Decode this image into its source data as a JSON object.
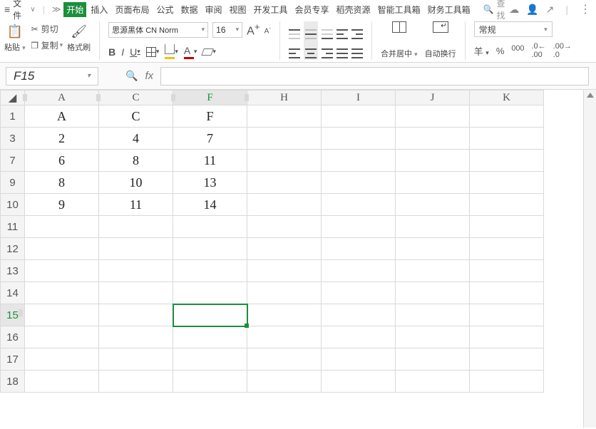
{
  "menu": {
    "file_label": "文件",
    "tabs": [
      "开始",
      "插入",
      "页面布局",
      "公式",
      "数据",
      "审阅",
      "视图",
      "开发工具",
      "会员专享",
      "稻壳资源",
      "智能工具箱",
      "财务工具箱"
    ],
    "search_placeholder": "查找"
  },
  "ribbon": {
    "paste_label": "粘贴",
    "cut_label": "剪切",
    "copy_label": "复制",
    "format_painter_label": "格式刷",
    "font_name": "思源黑体 CN Norm",
    "font_size": "16",
    "merge_label": "合并居中",
    "wrap_label": "自动换行",
    "number_format": "常规"
  },
  "name_box": "F15",
  "formula": "",
  "col_headers": [
    "A",
    "C",
    "F",
    "H",
    "I",
    "J",
    "K"
  ],
  "rows": [
    {
      "hdr": "1",
      "A": "A",
      "C": "C",
      "F": "F"
    },
    {
      "hdr": "3",
      "A": "2",
      "C": "4",
      "F": "7"
    },
    {
      "hdr": "7",
      "A": "6",
      "C": "8",
      "F": "11"
    },
    {
      "hdr": "9",
      "A": "8",
      "C": "10",
      "F": "13"
    },
    {
      "hdr": "10",
      "A": "9",
      "C": "11",
      "F": "14"
    },
    {
      "hdr": "11"
    },
    {
      "hdr": "12"
    },
    {
      "hdr": "13"
    },
    {
      "hdr": "14"
    },
    {
      "hdr": "15",
      "selected": true
    },
    {
      "hdr": "16"
    },
    {
      "hdr": "17"
    },
    {
      "hdr": "18"
    }
  ],
  "selected": {
    "row": "15",
    "col": "F"
  }
}
